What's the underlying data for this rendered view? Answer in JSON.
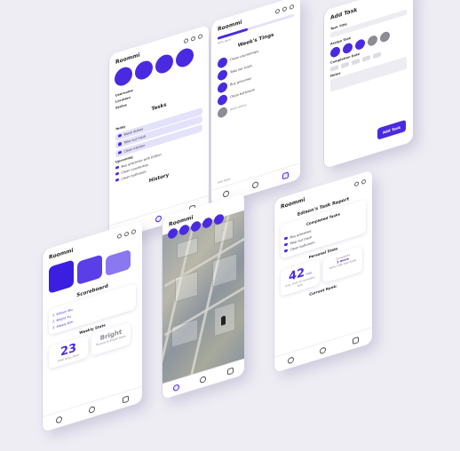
{
  "brand": "Roommi",
  "home": {
    "member_initials": [
      "",
      "",
      "",
      ""
    ],
    "info": [
      {
        "key": "Username",
        "value": ""
      },
      {
        "key": "Location",
        "value": ""
      },
      {
        "key": "Status",
        "value": ""
      }
    ],
    "tasks_title": "Tasks",
    "today_label": "Today",
    "today": [
      "Wash dishes",
      "Take out trash",
      "Clean kitchen"
    ],
    "upcoming_label": "Upcoming",
    "upcoming": [
      "Buy groceries with Edison",
      "Clean countertop",
      "Clean bathroom"
    ],
    "history_label": "History"
  },
  "week": {
    "progress_label": "40% done",
    "progress_value": 0.4,
    "title": "Week's Tings",
    "items": [
      "Clean countertops",
      "Take out trash",
      "Buy groceries",
      "Clean bathroom",
      "Wash dishes"
    ],
    "footer_left": "Add Tasks"
  },
  "add_task": {
    "title": "Add Task",
    "task_title_label": "Task Title",
    "assign_label": "Assign Task",
    "completion_label": "Completion Date",
    "notes_label": "Notes",
    "button": "Add Task"
  },
  "score": {
    "boxes": [
      {
        "value": "",
        "sub": "",
        "color": "#3b1fe0"
      },
      {
        "value": "",
        "sub": "",
        "color": "#5a3ee8"
      },
      {
        "value": "",
        "sub": "",
        "color": "#8a78f0"
      }
    ],
    "scoreboard_title": "Scoreboard",
    "rows": [
      {
        "name": "1. Edison Wu",
        "score": ""
      },
      {
        "name": "2. Bright Xu",
        "score": ""
      },
      {
        "name": "3. Alewis Kim",
        "score": ""
      }
    ],
    "weekly_label": "Weekly Stats",
    "stat_value": "23",
    "stat_text": "total tasks done",
    "stat2_value": "Bright",
    "stat2_text": "Passed to Bright tasks"
  },
  "map": {
    "brand": "Roommi"
  },
  "report": {
    "title": "Edison's Task Report",
    "completed_label": "Completed Tasks",
    "completed": [
      "Buy groceries",
      "Take out trash",
      "Clean bathroom"
    ],
    "personal_label": "Personal Stats",
    "mins_value": "42",
    "mins_unit": "min",
    "mins_text": "avg. time to complete task",
    "completed_more_a": "Completed",
    "completed_more_b": "3 more",
    "completed_more_c": "tasks than last week",
    "rank_label": "Current Rank:"
  },
  "colors": {
    "accent": "#4a2ae0",
    "background": "#eeedf4"
  }
}
